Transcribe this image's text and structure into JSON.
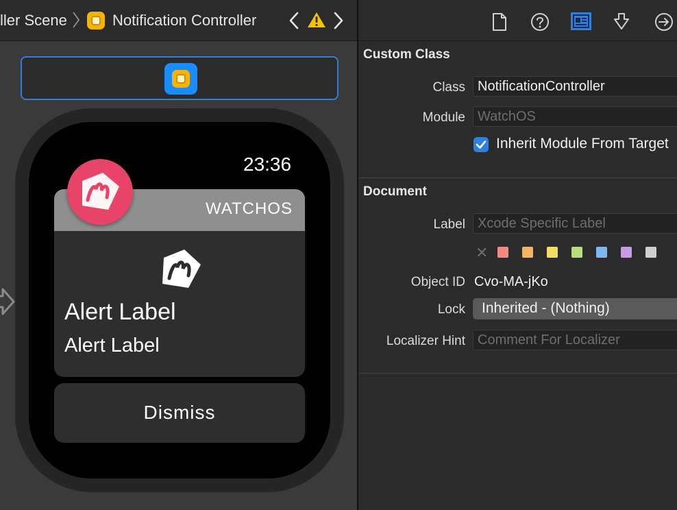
{
  "breadcrumb": {
    "scene": "ller Scene",
    "controller": "Notification Controller"
  },
  "watch": {
    "time": "23:36",
    "app_name": "WATCHOS",
    "alert_title": "Alert Label",
    "alert_body": "Alert Label",
    "dismiss": "Dismiss"
  },
  "inspector": {
    "custom_class": {
      "title": "Custom Class",
      "class_label": "Class",
      "class_value": "NotificationController",
      "module_label": "Module",
      "module_placeholder": "WatchOS",
      "inherit_label": "Inherit Module From Target",
      "inherit_checked": true
    },
    "document": {
      "title": "Document",
      "label_label": "Label",
      "label_placeholder": "Xcode Specific Label",
      "object_id_label": "Object ID",
      "object_id_value": "Cvo-MA-jKo",
      "lock_label": "Lock",
      "lock_value": "Inherited - (Nothing)",
      "localizer_label": "Localizer Hint",
      "localizer_placeholder": "Comment For Localizer"
    },
    "label_colors": [
      "#f08a86",
      "#f4b266",
      "#f3de6a",
      "#b6e07a",
      "#7cb8f2",
      "#c79be6",
      "#cfcfcf"
    ]
  },
  "colors": {
    "accent": "#2f7fde",
    "app_icon": "#e8446a",
    "controller_icon": "#f5b400",
    "warning": "#f5c400"
  },
  "icons": {
    "breadcrumb_separator": "chevron-right-icon",
    "controller": "interface-controller-icon",
    "nav_back": "chevron-left-icon",
    "nav_forward": "chevron-right-icon",
    "warning": "warning-triangle-icon",
    "file_inspector": "document-icon",
    "help": "question-circle-icon",
    "identity_inspector": "identity-card-icon",
    "attributes_inspector": "attributes-icon",
    "connections_inspector": "arrow-circle-icon",
    "entry_point": "entry-arrow-icon"
  }
}
